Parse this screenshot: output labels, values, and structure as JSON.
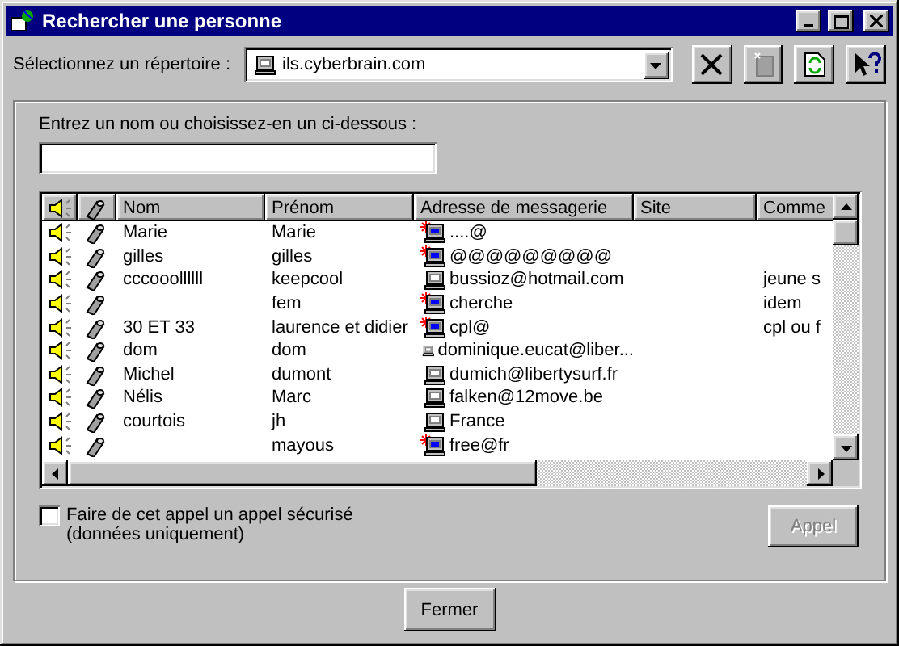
{
  "window": {
    "title": "Rechercher une personne"
  },
  "directory": {
    "label": "Sélectionnez un répertoire :",
    "value": "ils.cyberbrain.com"
  },
  "search": {
    "label": "Entrez un nom ou choisissez-en un ci-dessous :"
  },
  "table": {
    "columns": [
      "Nom",
      "Prénom",
      "Adresse de messagerie",
      "Site",
      "Comme"
    ],
    "rows": [
      {
        "nom": "Marie",
        "prenom": "Marie",
        "email": "....@",
        "kind": "new"
      },
      {
        "nom": "gilles",
        "prenom": "gilles",
        "email": "@@@@@@@@@",
        "kind": "new"
      },
      {
        "nom": "cccooollllll",
        "prenom": "keepcool",
        "email": "bussioz@hotmail.com",
        "comment": "jeune s",
        "kind": "standard"
      },
      {
        "prenom": "fem",
        "email": "cherche",
        "comment": "idem",
        "kind": "new"
      },
      {
        "nom": "30 ET 33",
        "prenom": "laurence et didier",
        "email": "cpl@",
        "comment": "cpl ou f",
        "kind": "new"
      },
      {
        "nom": "dom",
        "prenom": "dom",
        "email": "dominique.eucat@liber...",
        "kind": "standard"
      },
      {
        "nom": "Michel",
        "prenom": "dumont",
        "email": "dumich@libertysurf.fr",
        "kind": "standard"
      },
      {
        "nom": "Nélis",
        "prenom": "Marc",
        "email": "falken@12move.be",
        "kind": "standard"
      },
      {
        "nom": "courtois",
        "prenom": "jh",
        "email": "France",
        "kind": "standard"
      },
      {
        "prenom": "mayous",
        "email": "free@fr",
        "kind": "new"
      }
    ]
  },
  "secure_call": {
    "label": "Faire de cet appel un appel sécurisé",
    "note": "(données uniquement)",
    "checked": false
  },
  "call_button": {
    "label": "Appel",
    "disabled": true
  },
  "close_button": {
    "label": "Fermer"
  }
}
